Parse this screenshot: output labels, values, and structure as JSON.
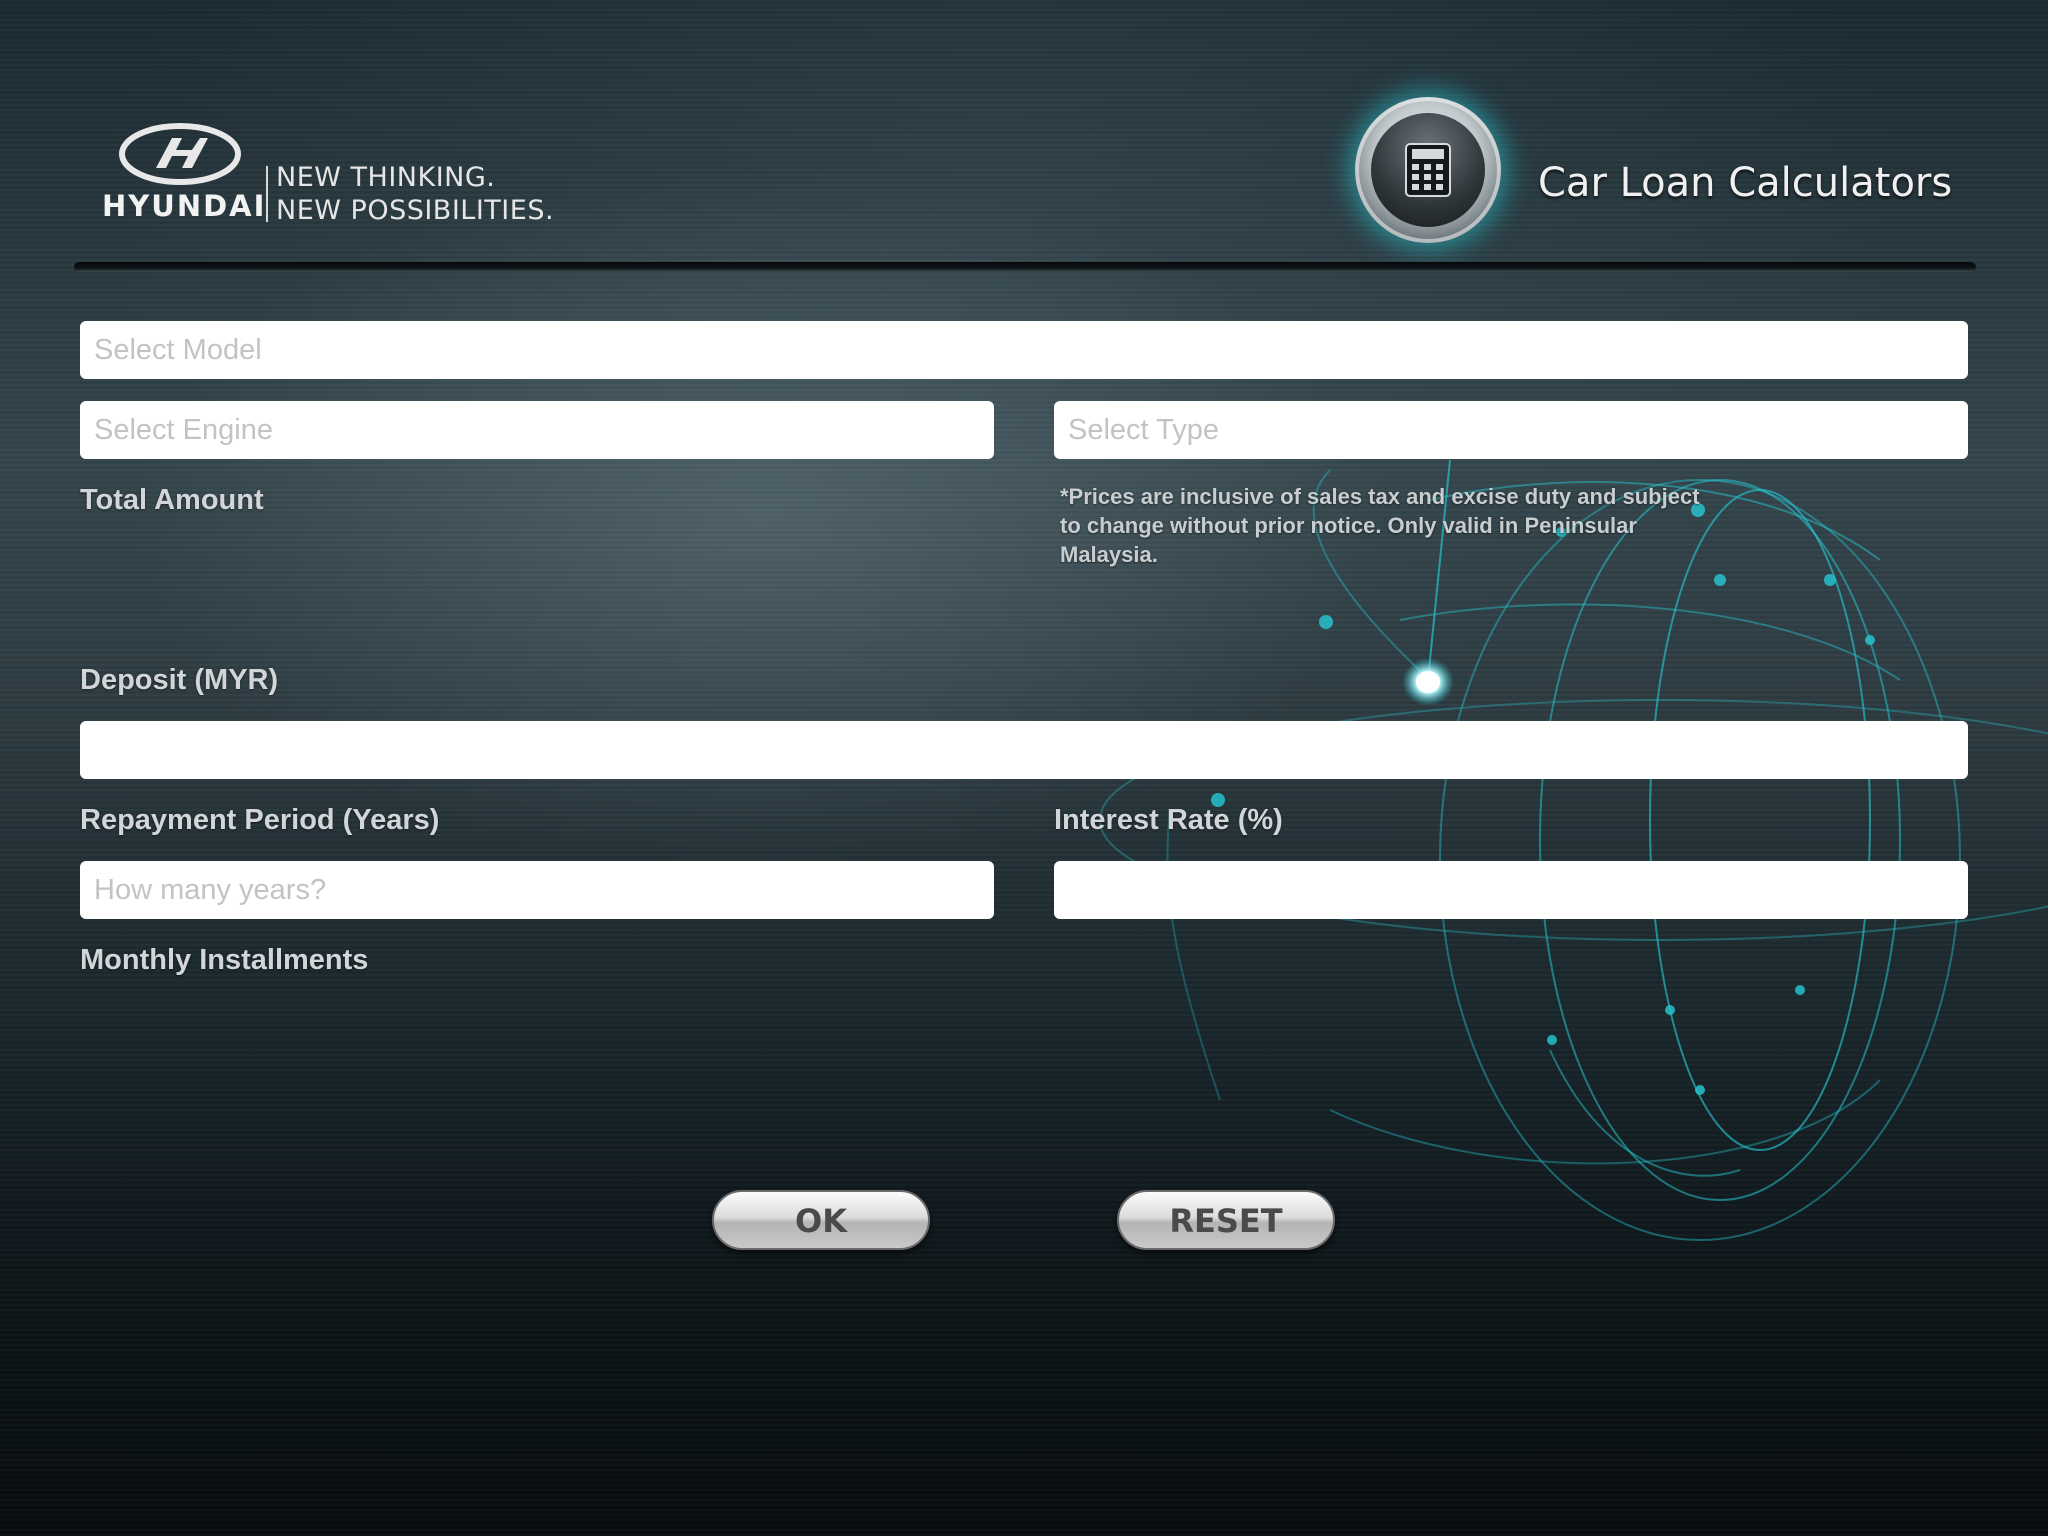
{
  "header": {
    "brand": "HYUNDAI",
    "tagline_line1": "NEW THINKING.",
    "tagline_line2": "NEW POSSIBILITIES.",
    "title": "Car Loan Calculators",
    "calculator_icon": "calculator-icon"
  },
  "form": {
    "model": {
      "placeholder": "Select Model",
      "value": ""
    },
    "engine": {
      "placeholder": "Select Engine",
      "value": ""
    },
    "type": {
      "placeholder": "Select Type",
      "value": ""
    },
    "total_amount_label": "Total Amount",
    "price_note": "*Prices are inclusive of sales tax and excise duty and subject to change without prior notice. Only valid in Peninsular Malaysia.",
    "deposit_label": "Deposit (MYR)",
    "deposit": {
      "placeholder": "",
      "value": ""
    },
    "years_label": "Repayment Period (Years)",
    "years": {
      "placeholder": "How many years?",
      "value": ""
    },
    "rate_label": "Interest Rate (%)",
    "rate": {
      "placeholder": "",
      "value": ""
    },
    "monthly_label": "Monthly Installments"
  },
  "buttons": {
    "ok": "OK",
    "reset": "RESET"
  },
  "colors": {
    "accent_glow": "#2ad2dc",
    "background_dark": "#0e171b",
    "label_text": "#d2d6d8"
  }
}
